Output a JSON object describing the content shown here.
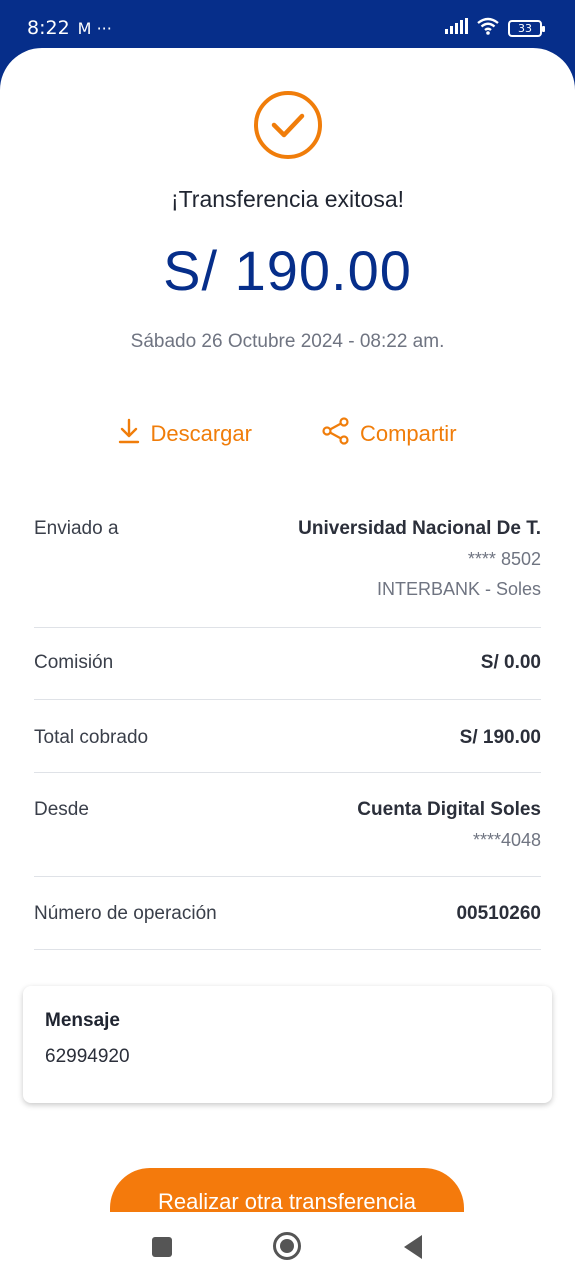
{
  "status_bar": {
    "time": "8:22",
    "notif_icons": "M ···",
    "battery": "33",
    "icons": [
      "signal-icon",
      "wifi-icon",
      "battery-icon"
    ]
  },
  "header": {
    "title": "¡Transferencia exitosa!",
    "amount": "S/ 190.00",
    "date": "Sábado 26 Octubre 2024 - 08:22 am."
  },
  "actions": {
    "download_label": "Descargar",
    "share_label": "Compartir"
  },
  "details": {
    "sent_to": {
      "label": "Enviado a",
      "name": "Universidad Nacional De T.",
      "account": "**** 8502",
      "bank": "INTERBANK - Soles"
    },
    "commission": {
      "label": "Comisión",
      "value": "S/ 0.00"
    },
    "total": {
      "label": "Total cobrado",
      "value": "S/ 190.00"
    },
    "from": {
      "label": "Desde",
      "account_name": "Cuenta Digital Soles",
      "account_number": "****4048"
    },
    "operation": {
      "label": "Número de operación",
      "value": "00510260"
    }
  },
  "message": {
    "title": "Mensaje",
    "text": "62994920"
  },
  "cta": {
    "label": "Realizar otra transferencia"
  },
  "colors": {
    "brand_blue": "#062e8a",
    "accent_orange": "#f07d0a"
  }
}
